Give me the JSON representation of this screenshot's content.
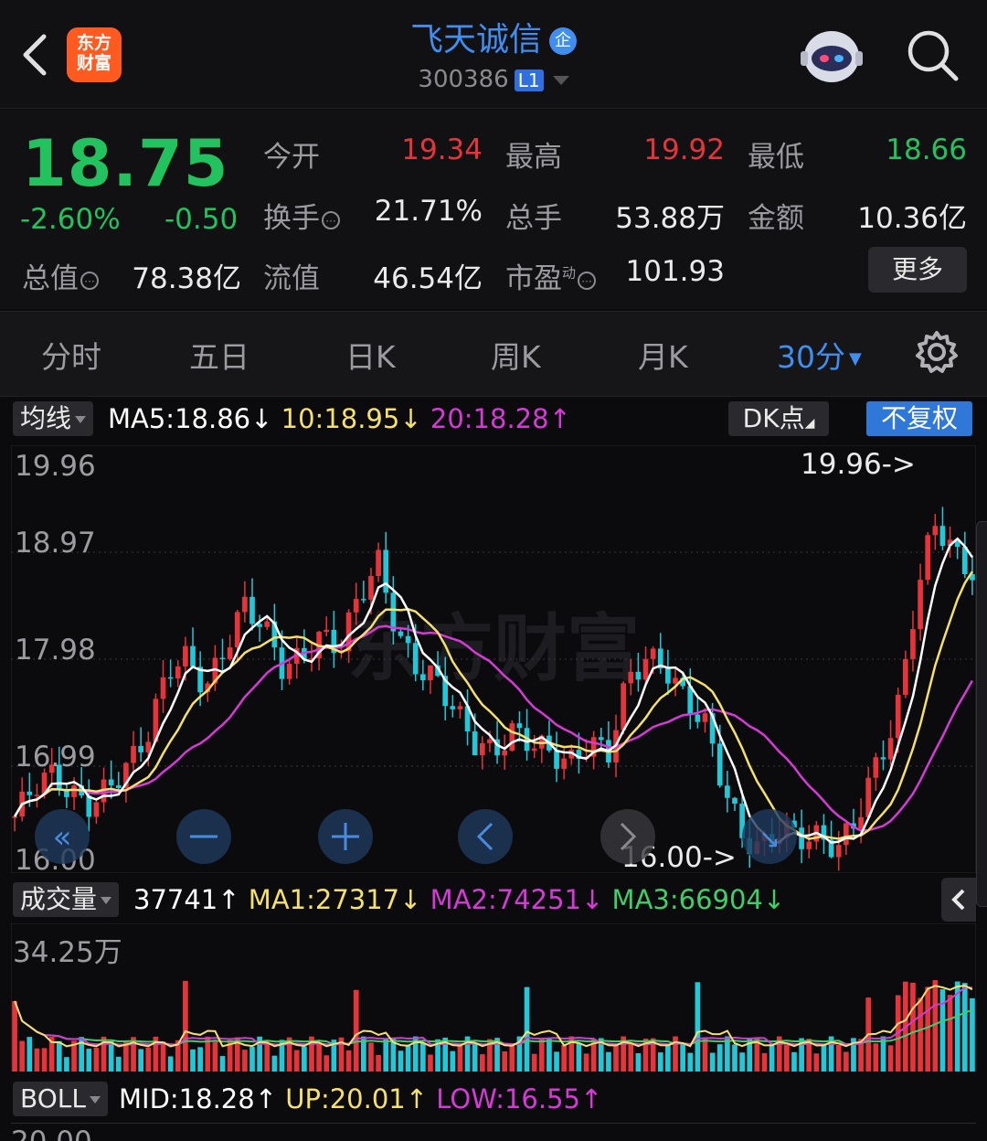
{
  "header": {
    "logo_text": "东方财富",
    "stock_name": "飞天诚信",
    "badge": "企",
    "code": "300386",
    "level": "L1"
  },
  "quote": {
    "price": "18.75",
    "change_pct": "-2.60%",
    "change_val": "-0.50",
    "rows": [
      [
        {
          "label": "今开",
          "value": "19.34",
          "tone": "red"
        },
        {
          "label": "最高",
          "value": "19.92",
          "tone": "red"
        },
        {
          "label": "最低",
          "value": "18.66",
          "tone": "green"
        }
      ],
      [
        {
          "label": "换手",
          "value": "21.71%",
          "tone": "white",
          "info": true
        },
        {
          "label": "总手",
          "value": "53.88万",
          "tone": "white"
        },
        {
          "label": "金额",
          "value": "10.36亿",
          "tone": "white"
        }
      ]
    ],
    "total_value_label": "总值",
    "total_value": "78.38亿",
    "float_label": "流值",
    "float_value": "46.54亿",
    "pe_label": "市盈",
    "pe_sup": "动",
    "pe_value": "101.93",
    "more": "更多"
  },
  "tabs": [
    {
      "label": "分时",
      "active": false
    },
    {
      "label": "五日",
      "active": false
    },
    {
      "label": "日K",
      "active": false
    },
    {
      "label": "周K",
      "active": false
    },
    {
      "label": "月K",
      "active": false
    },
    {
      "label": "30分",
      "active": true
    }
  ],
  "ma_bar": {
    "selector": "均线",
    "ma5": "MA5:18.86",
    "ma10": "10:18.95",
    "ma20": "20:18.28",
    "dk": "DK点",
    "adjust": "不复权"
  },
  "price_chart": {
    "y_labels": [
      "19.96",
      "18.97",
      "17.98",
      "16.99",
      "16.00"
    ],
    "high_marker": "19.96->",
    "low_marker": "16.00->",
    "watermark": "东方财富",
    "colors": {
      "up": "#e8333a",
      "down": "#20c8d8",
      "ma5": "#ffffff",
      "ma10": "#f5e06a",
      "ma20": "#d63ad6"
    }
  },
  "volume_bar": {
    "selector": "成交量",
    "vol": "37741",
    "ma1": "MA1:27317",
    "ma2": "MA2:74251",
    "ma3": "MA3:66904",
    "y_label": "34.25万"
  },
  "boll_bar": {
    "selector": "BOLL",
    "mid": "MID:18.28",
    "up": "UP:20.01",
    "low": "LOW:16.55",
    "partial_label": "20.00"
  },
  "arrows": {
    "up": "↑",
    "down": "↓"
  }
}
